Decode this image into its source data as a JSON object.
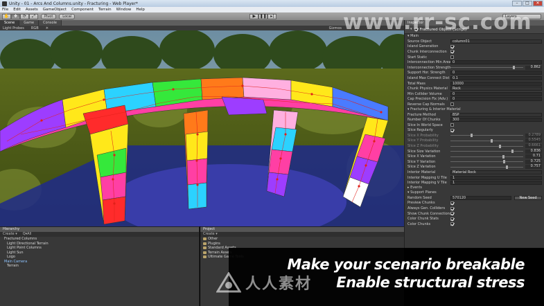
{
  "window": {
    "title": "Unity - 01 - Arcs And Columns.unity - Fracturing - Web Player*",
    "controls": [
      "–",
      "□",
      "✕"
    ]
  },
  "menu": [
    "File",
    "Edit",
    "Assets",
    "GameObject",
    "Component",
    "Terrain",
    "Window",
    "Help"
  ],
  "toolbar": {
    "pivot_label": "Pivot",
    "local_label": "Local",
    "layout_label": "Layers"
  },
  "scene": {
    "tabs": [
      "Scene",
      "Game",
      "Console"
    ],
    "sub_toolbar": [
      "Light Probes",
      "RGB",
      "☀"
    ],
    "gizmos_label": "Gizmos"
  },
  "inspector": {
    "tab": "Inspector",
    "component_title": "Fractured Object (Script)",
    "main_header": "Main",
    "main_rows": [
      {
        "label": "Source Object",
        "type": "object",
        "value": "column01"
      },
      {
        "label": "Island Generation",
        "type": "check",
        "checked": true
      },
      {
        "label": "Chunk Interconnection",
        "type": "check",
        "checked": true
      },
      {
        "label": "Start Static",
        "type": "check",
        "checked": false
      },
      {
        "label": "Interconnection Min Area",
        "type": "field",
        "value": "0"
      },
      {
        "label": "Interconnection Strength",
        "type": "slider",
        "value": "0.862",
        "level": 0.86
      },
      {
        "label": "Support Hor. Strength",
        "type": "field",
        "value": "0"
      },
      {
        "label": "Island Max Connect Dist",
        "type": "field",
        "value": "0.1"
      },
      {
        "label": "Total Mass",
        "type": "field",
        "value": "10000"
      },
      {
        "label": "Chunk Physics Material",
        "type": "object",
        "value": "Rock"
      },
      {
        "label": "Min Collider Volume",
        "type": "field",
        "value": "0"
      },
      {
        "label": "Cap Precision Fix (Adv.)",
        "type": "field",
        "value": "0"
      },
      {
        "label": "Reverse Cap Normals",
        "type": "check",
        "checked": false
      }
    ],
    "fracture_header": "Fracturing & Interior Material",
    "fracture_rows": [
      {
        "label": "Fracture Method",
        "type": "object",
        "value": "BSP"
      },
      {
        "label": "Number Of Chunks",
        "type": "field",
        "value": "300"
      },
      {
        "label": "Slice In World Space",
        "type": "check",
        "checked": false
      },
      {
        "label": "Slice Regularly",
        "type": "check",
        "checked": true
      },
      {
        "label": "Slice X Probability",
        "type": "slider",
        "value": "0.2789",
        "level": 0.28,
        "dim": true
      },
      {
        "label": "Slice Y Probability",
        "type": "slider",
        "value": "0.5545",
        "level": 0.55,
        "dim": true
      },
      {
        "label": "Slice Z Probability",
        "type": "slider",
        "value": "0.6661",
        "level": 0.67,
        "dim": true
      },
      {
        "label": "Slice Size Variation",
        "type": "slider",
        "value": "0.836",
        "level": 0.84
      },
      {
        "label": "Slice X Variation",
        "type": "slider",
        "value": "0.71",
        "level": 0.71
      },
      {
        "label": "Slice Y Variation",
        "type": "slider",
        "value": "0.725",
        "level": 0.72
      },
      {
        "label": "Slice Z Variation",
        "type": "slider",
        "value": "0.757",
        "level": 0.76
      },
      {
        "label": "Interior Material",
        "type": "object",
        "value": "Material Rock"
      },
      {
        "label": "Interior Mapping U Tile",
        "type": "field",
        "value": "1"
      },
      {
        "label": "Interior Mapping V Tile",
        "type": "field",
        "value": "1"
      }
    ],
    "events_header": "Events",
    "support_header": "Support Planes",
    "seed_label": "Random Seed",
    "seed_value": "570120",
    "new_seed_label": "New Seed",
    "bottom_rows": [
      {
        "label": "Preview Chunks",
        "checked": true
      },
      {
        "label": "Always Gen. Colliders",
        "checked": true
      },
      {
        "label": "Show Chunk Connections",
        "checked": true
      },
      {
        "label": "Color Chunk Stats",
        "checked": true
      },
      {
        "label": "Color Chunks",
        "checked": true
      }
    ]
  },
  "hierarchy": {
    "tab": "Hierarchy",
    "create_label": "Create ▾",
    "search": "Q▾All",
    "items": [
      {
        "label": "Fractured Columns",
        "selected": false,
        "child": false
      },
      {
        "label": "Light Directional Terrain",
        "selected": false,
        "child": true
      },
      {
        "label": "Light Point Columns",
        "selected": false,
        "child": true
      },
      {
        "label": "Light Sun",
        "selected": false,
        "child": true
      },
      {
        "label": "Logo",
        "selected": false,
        "child": true
      },
      {
        "label": "Main Camera",
        "selected": true,
        "child": false
      },
      {
        "label": "Terrain",
        "selected": false,
        "child": true
      }
    ]
  },
  "project": {
    "tab": "Project",
    "create_label": "Create ▾",
    "folders": [
      "Other",
      "Plugins",
      "Standard Assets",
      "Terrain Assets",
      "Ultimate Game Tools"
    ]
  },
  "caption": {
    "line1": "Make your scenario breakable",
    "line2": "Enable structural stress"
  },
  "watermark": {
    "top": "www.rr-sc.com",
    "bottom": "人人素材"
  },
  "colors": {
    "editor_bg": "#383838",
    "chunk_palette": [
      "#ff3fa4",
      "#ffe81a",
      "#35e83b",
      "#2bd2ff",
      "#ff7a1a",
      "#9d3dff",
      "#ff2b2b",
      "#ffffff",
      "#4a7bff",
      "#ffb0e0"
    ],
    "water": "#1f2a8a"
  }
}
